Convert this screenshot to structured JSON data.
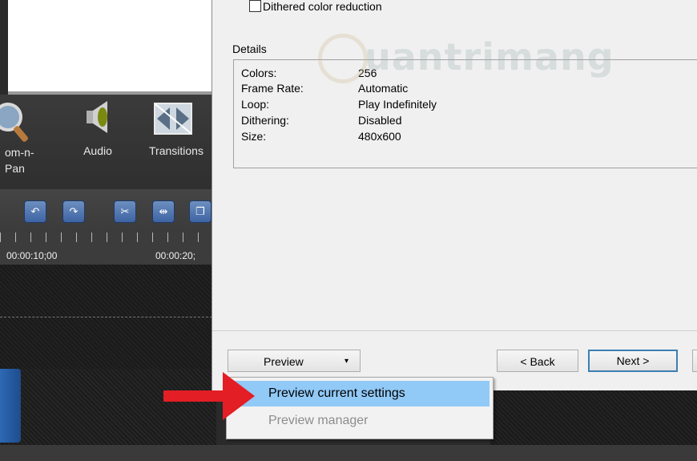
{
  "background_app": {
    "tools": {
      "zoom_label_line1": "om-n-",
      "zoom_label_line2": "Pan",
      "audio_label": "Audio",
      "transitions_label": "Transitions"
    },
    "timeline": {
      "time_label_1": "00:00:10;00",
      "time_label_2": "00:00:20;"
    }
  },
  "dialog": {
    "dithered_label": "Dithered color reduction",
    "details_title": "Details",
    "details": [
      {
        "key": "Colors:",
        "value": "256"
      },
      {
        "key": "Frame Rate:",
        "value": "Automatic"
      },
      {
        "key": "Loop:",
        "value": "Play Indefinitely"
      },
      {
        "key": "Dithering:",
        "value": "Disabled"
      },
      {
        "key": "Size:",
        "value": "480x600"
      }
    ],
    "watermark_text": "uantrimang",
    "buttons": {
      "preview": "Preview",
      "preview_caret": "▾",
      "back": "< Back",
      "next": "Next >"
    }
  },
  "preview_menu": {
    "items": [
      {
        "label": "Preview current settings",
        "state": "highlighted"
      },
      {
        "label": "Preview manager",
        "state": "disabled"
      }
    ]
  },
  "colors": {
    "menu_highlight": "#91c9f7",
    "arrow": "#e31e24",
    "timeline_bg": "#1c1c1c",
    "dialog_bg": "#f0f0f0"
  }
}
